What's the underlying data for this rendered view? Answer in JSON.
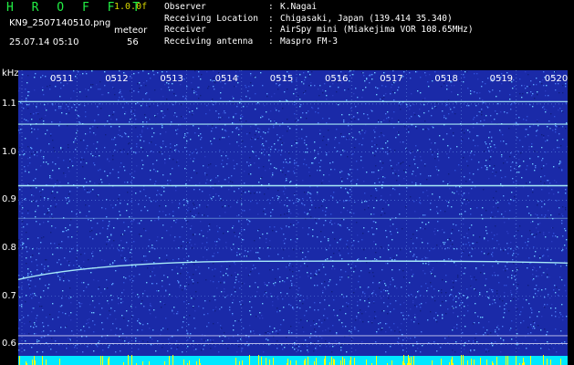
{
  "header": {
    "app_title": "H R O F F T",
    "version": "1.0.0f",
    "filename": "KN9_2507140510.png",
    "datetime": "25.07.14 05:10",
    "meteor_label": "meteor",
    "meteor_count": "56"
  },
  "info": [
    {
      "key": "Observer",
      "sep": ":",
      "value": "K.Nagai"
    },
    {
      "key": "Receiving Location",
      "sep": ":",
      "value": "Chigasaki, Japan (139.414 35.340)"
    },
    {
      "key": "Receiver",
      "sep": ":",
      "value": "AirSpy mini (Miakejima VOR 108.65MHz)"
    },
    {
      "key": "Receiving antenna",
      "sep": ":",
      "value": "Maspro FM-3"
    }
  ],
  "chart_data": {
    "type": "heatmap",
    "ylabel": "kHz",
    "x_ticks": [
      "0511",
      "0512",
      "0513",
      "0514",
      "0515",
      "0516",
      "0517",
      "0518",
      "0519",
      "0520"
    ],
    "y_ticks": [
      "1.1",
      "1.0",
      "0.9",
      "0.8",
      "0.7",
      "0.6"
    ],
    "ylim": [
      0.58,
      1.17
    ],
    "signal_lines_khz": [
      1.105,
      1.058,
      0.93,
      0.862
    ],
    "drifting_signal": {
      "start_khz": 0.735,
      "settled_khz": 0.773
    },
    "reference_lines_khz": [
      0.618,
      0.602
    ],
    "colors": {
      "background": "#1a2aa8",
      "signal": "#b8ffff",
      "baseline": "#00e8ff",
      "burst": "#ffff00",
      "grid": "#7fb4ff"
    }
  }
}
